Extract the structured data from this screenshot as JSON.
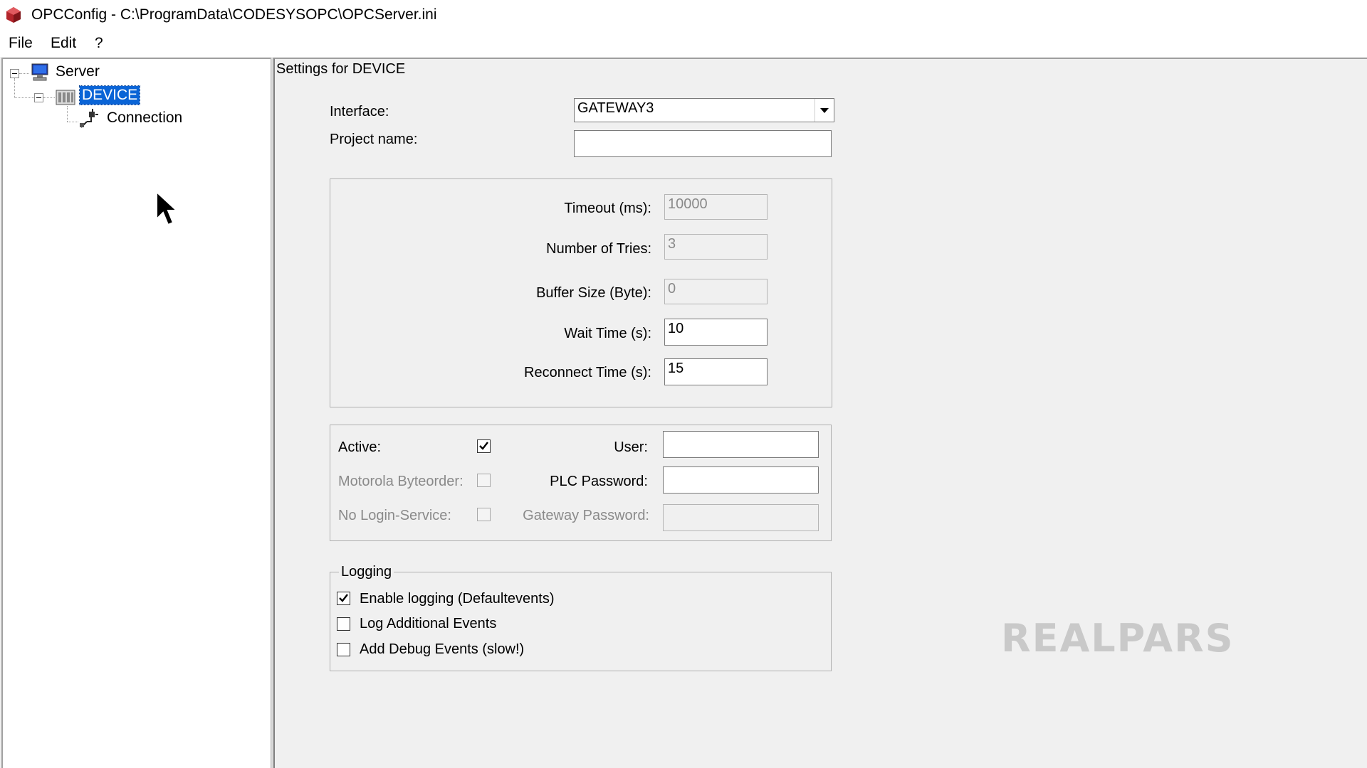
{
  "window": {
    "title": "OPCConfig - C:\\ProgramData\\CODESYSOPC\\OPCServer.ini"
  },
  "menu": {
    "items": [
      "File",
      "Edit",
      "?"
    ]
  },
  "tree": {
    "server": "Server",
    "device": "DEVICE",
    "connection": "Connection"
  },
  "settings": {
    "header": "Settings for DEVICE",
    "interface_label": "Interface:",
    "interface_value": "GATEWAY3",
    "project_label": "Project name:",
    "project_value": "",
    "timeout_label": "Timeout (ms):",
    "timeout_value": "10000",
    "tries_label": "Number of Tries:",
    "tries_value": "3",
    "buffer_label": "Buffer Size (Byte):",
    "buffer_value": "0",
    "wait_label": "Wait Time (s):",
    "wait_value": "10",
    "reconnect_label": "Reconnect Time (s):",
    "reconnect_value": "15",
    "active_label": "Active:",
    "active_checked": true,
    "motorola_label": "Motorola Byteorder:",
    "motorola_checked": false,
    "nologin_label": "No Login-Service:",
    "nologin_checked": false,
    "user_label": "User:",
    "user_value": "",
    "plc_password_label": "PLC Password:",
    "plc_password_value": "",
    "gateway_password_label": "Gateway Password:",
    "gateway_password_value": ""
  },
  "logging": {
    "legend": "Logging",
    "enable_label": "Enable logging (Defaultevents)",
    "enable_checked": true,
    "additional_label": "Log Additional Events",
    "additional_checked": false,
    "debug_label": "Add Debug Events (slow!)",
    "debug_checked": false
  },
  "watermark": "REALPARS"
}
